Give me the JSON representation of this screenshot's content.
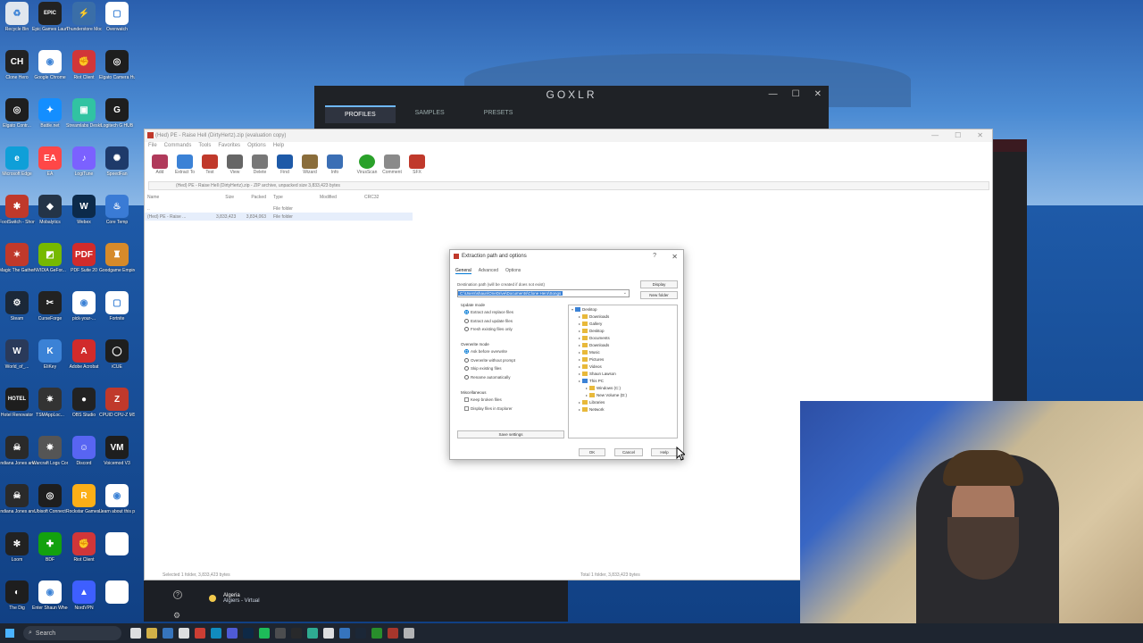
{
  "desktop": {
    "icons": [
      {
        "label": "Recycle Bin",
        "color": "#e0e6ee",
        "glyph": "♻"
      },
      {
        "label": "Epic Games Launcher",
        "color": "#222222",
        "glyph": "EPIC"
      },
      {
        "label": "Thunderstore Mod Mana...",
        "color": "#3a6ea8",
        "glyph": "⚡"
      },
      {
        "label": "Overwatch",
        "color": "#ffffff",
        "glyph": "▢"
      },
      {
        "label": "Clone Hero",
        "color": "#222222",
        "glyph": "CH"
      },
      {
        "label": "Google Chrome",
        "color": "#ffffff",
        "glyph": "◉"
      },
      {
        "label": "Riot Client",
        "color": "#d13639",
        "glyph": "✊"
      },
      {
        "label": "Elgato Camera Hub",
        "color": "#1e1e1e",
        "glyph": "◎"
      },
      {
        "label": "Elgato Contr...",
        "color": "#1e1e1e",
        "glyph": "◎"
      },
      {
        "label": "Battle.net",
        "color": "#148eff",
        "glyph": "✦"
      },
      {
        "label": "Streamlabs Desktop",
        "color": "#31c3a2",
        "glyph": "▣"
      },
      {
        "label": "Logitech G HUB",
        "color": "#1e1e1e",
        "glyph": "G"
      },
      {
        "label": "Microsoft Edge",
        "color": "#0f9fd8",
        "glyph": "e"
      },
      {
        "label": "EA",
        "color": "#ff4747",
        "glyph": "EA"
      },
      {
        "label": "LogiTune",
        "color": "#7b61ff",
        "glyph": "♪"
      },
      {
        "label": "SpeedFan",
        "color": "#1e3a6a",
        "glyph": "✺"
      },
      {
        "label": "FootSwitch - Shortcut",
        "color": "#c0392b",
        "glyph": "✱"
      },
      {
        "label": "Mobalytics",
        "color": "#243447",
        "glyph": "◆"
      },
      {
        "label": "Webex",
        "color": "#0c2a4a",
        "glyph": "W"
      },
      {
        "label": "Core Temp",
        "color": "#3a7bd5",
        "glyph": "♨"
      },
      {
        "label": "Magic The Gathering",
        "color": "#c0392b",
        "glyph": "✶"
      },
      {
        "label": "NVIDIA GeFor...",
        "color": "#76b900",
        "glyph": "◩"
      },
      {
        "label": "PDF Suite 20",
        "color": "#d12b2b",
        "glyph": "PDF"
      },
      {
        "label": "Goodgame Empire",
        "color": "#d68a2a",
        "glyph": "♜"
      },
      {
        "label": "Steam",
        "color": "#1b2838",
        "glyph": "⚙"
      },
      {
        "label": "CurseForge",
        "color": "#222222",
        "glyph": "✂"
      },
      {
        "label": "pick-your-...",
        "color": "#ffffff",
        "glyph": "◉"
      },
      {
        "label": "Fortnite",
        "color": "#ffffff",
        "glyph": "▢"
      },
      {
        "label": "World_of_...",
        "color": "#2a3a5a",
        "glyph": "W"
      },
      {
        "label": "EliKey",
        "color": "#3b82d6",
        "glyph": "K"
      },
      {
        "label": "Adobe Acrobat",
        "color": "#d12b2b",
        "glyph": "A"
      },
      {
        "label": "iCUE",
        "color": "#1e1e1e",
        "glyph": "◯"
      },
      {
        "label": "Hotel Renovator",
        "color": "#1e1e1e",
        "glyph": "HOTEL"
      },
      {
        "label": "TSMAppLoc...",
        "color": "#333333",
        "glyph": "✷"
      },
      {
        "label": "OBS Studio",
        "color": "#222222",
        "glyph": "●"
      },
      {
        "label": "CPUID CPU-Z MSI",
        "color": "#c0392b",
        "glyph": "Z"
      },
      {
        "label": "Indiana Jones and the...",
        "color": "#2a2a2a",
        "glyph": "☠"
      },
      {
        "label": "Warcraft Logs Comp...",
        "color": "#555555",
        "glyph": "✵"
      },
      {
        "label": "Discord",
        "color": "#5865f2",
        "glyph": "☺"
      },
      {
        "label": "Voicemod V3",
        "color": "#1e1e1e",
        "glyph": "VM"
      },
      {
        "label": "Indiana Jones and the...",
        "color": "#2a2a2a",
        "glyph": "☠"
      },
      {
        "label": "Ubisoft Connect",
        "color": "#1e1e1e",
        "glyph": "◎"
      },
      {
        "label": "Rockstar Games L...",
        "color": "#fcaf17",
        "glyph": "R"
      },
      {
        "label": "Learn about this picture",
        "color": "#ffffff",
        "glyph": "◉"
      },
      {
        "label": "Loom",
        "color": "#222222",
        "glyph": "✻"
      },
      {
        "label": "BDF",
        "color": "#13a10e",
        "glyph": "✚"
      },
      {
        "label": "Riot Client",
        "color": "#d13639",
        "glyph": "✊"
      },
      {
        "label": "",
        "color": "#ffffff",
        "glyph": ""
      },
      {
        "label": "The Dig",
        "color": "#1e1e1e",
        "glyph": "◐"
      },
      {
        "label": "Enter Shaun Wheel AB...",
        "color": "#ffffff",
        "glyph": "◉"
      },
      {
        "label": "NordVPN",
        "color": "#3e5fff",
        "glyph": "▲"
      },
      {
        "label": "",
        "color": "#ffffff",
        "glyph": ""
      }
    ]
  },
  "goxlr": {
    "title": "GOXLR",
    "tabs": [
      "PROFILES",
      "SAMPLES",
      "PRESETS"
    ],
    "active_tab": "PROFILES"
  },
  "winrar": {
    "title": "(Hed) PE - Raise Hell (DirtyHertz).zip (evaluation copy)",
    "menu": [
      "File",
      "Commands",
      "Tools",
      "Favorites",
      "Options",
      "Help"
    ],
    "toolbar": [
      {
        "label": "Add",
        "color": "#b03a5b"
      },
      {
        "label": "Extract To",
        "color": "#3b82d6"
      },
      {
        "label": "Test",
        "color": "#c0392b"
      },
      {
        "label": "View",
        "color": "#666666"
      },
      {
        "label": "Delete",
        "color": "#777777"
      },
      {
        "label": "Find",
        "color": "#1e5aa8"
      },
      {
        "label": "Wizard",
        "color": "#8a6d3b"
      },
      {
        "label": "Info",
        "color": "#3b6fb5"
      },
      {
        "label": "VirusScan",
        "color": "#2aa12a"
      },
      {
        "label": "Comment",
        "color": "#8a8a8a"
      },
      {
        "label": "SFX",
        "color": "#c0392b"
      }
    ],
    "path": "(Hed) PE - Raise Hell (DirtyHertz).zip - ZIP archive, unpacked size 3,833,423 bytes",
    "columns": [
      "Name",
      "Size",
      "Packed",
      "Type",
      "Modified",
      "CRC32"
    ],
    "rows": [
      {
        "name": "..",
        "size": "",
        "packed": "",
        "type": "File folder"
      },
      {
        "name": "(Hed) PE - Raise ...",
        "size": "3,833,423",
        "packed": "3,834,063",
        "type": "File folder"
      }
    ],
    "status_left": "Selected 1 folder, 3,833,423 bytes",
    "status_right": "Total 1 folder, 3,833,423 bytes"
  },
  "dialog": {
    "title": "Extraction path and options",
    "tabs": [
      "General",
      "Advanced",
      "Options"
    ],
    "dest_label": "Destination path (will be created if does not exist)",
    "dest_value": "C:\\Users\\shaun\\OneDrive\\Documents\\Clone Hero\\Songs",
    "display_btn": "Display",
    "new_folder_btn": "New folder",
    "update_mode_label": "Update mode",
    "update_options": [
      {
        "label": "Extract and replace files",
        "on": true
      },
      {
        "label": "Extract and update files",
        "on": false
      },
      {
        "label": "Fresh existing files only",
        "on": false
      }
    ],
    "overwrite_label": "Overwrite mode",
    "overwrite_options": [
      {
        "label": "Ask before overwrite",
        "on": true
      },
      {
        "label": "Overwrite without prompt",
        "on": false
      },
      {
        "label": "Skip existing files",
        "on": false
      },
      {
        "label": "Rename automatically",
        "on": false
      }
    ],
    "misc_label": "Miscellaneous",
    "misc_options": [
      "Keep broken files",
      "Display files in Explorer"
    ],
    "save_settings": "Save settings",
    "tree": [
      {
        "label": "Desktop",
        "indent": 0
      },
      {
        "label": "Downloads",
        "indent": 1
      },
      {
        "label": "Gallery",
        "indent": 1
      },
      {
        "label": "Desktop",
        "indent": 1
      },
      {
        "label": "Documents",
        "indent": 1
      },
      {
        "label": "Downloads",
        "indent": 1
      },
      {
        "label": "Music",
        "indent": 1
      },
      {
        "label": "Pictures",
        "indent": 1
      },
      {
        "label": "Videos",
        "indent": 1
      },
      {
        "label": "Shaun Lawson",
        "indent": 1
      },
      {
        "label": "This PC",
        "indent": 1
      },
      {
        "label": "Windows (C:)",
        "indent": 2
      },
      {
        "label": "New Volume (D:)",
        "indent": 2
      },
      {
        "label": "Libraries",
        "indent": 1
      },
      {
        "label": "Network",
        "indent": 1
      }
    ],
    "ok": "OK",
    "cancel": "Cancel",
    "help": "Help"
  },
  "weather": {
    "line1": "Algeria",
    "line2": "Algiers - Virtual"
  },
  "taskbar": {
    "search": "Search",
    "icons": [
      "#ffffff",
      "#f2c94c",
      "#3b82d6",
      "#ffffff",
      "#ea4335",
      "#0f9fd8",
      "#5865f2",
      "#0c2a4a",
      "#1ed760",
      "#555555",
      "#2a2a2a",
      "#31c3a2",
      "#ffffff",
      "#3b82d6",
      "#1b2838",
      "#2aa12a",
      "#c0392b",
      "#cccccc"
    ]
  }
}
